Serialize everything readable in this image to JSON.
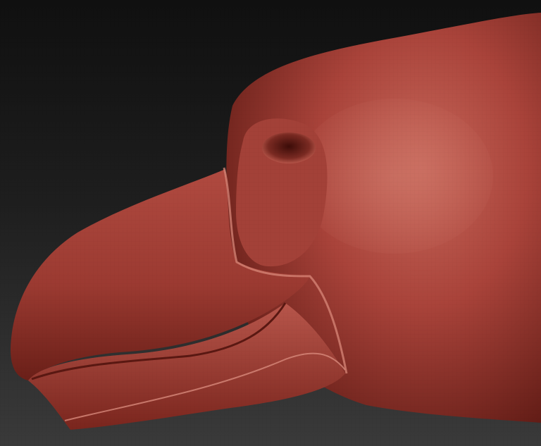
{
  "scene": {
    "subject": "sculpted-bird-head",
    "material_base": "#b0453a",
    "material_light": "#cf6b5c",
    "material_shadow": "#5a1812",
    "background_top": "#101010",
    "background_bottom": "#3a3a3a"
  }
}
